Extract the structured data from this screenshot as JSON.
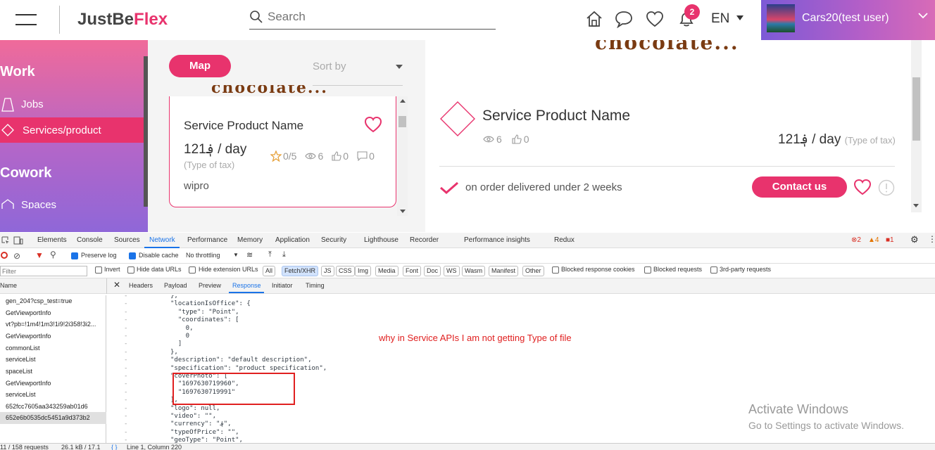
{
  "header": {
    "logo_part1": "JustBe",
    "logo_part2": "Flex",
    "search_placeholder": "Search",
    "notification_count": "2",
    "language": "EN",
    "user_name": "Cars20(test user)"
  },
  "sidebar": {
    "section_work": "Work",
    "item_jobs": "Jobs",
    "item_services": "Services/product",
    "section_cowork": "Cowork",
    "item_spaces": "Spaces"
  },
  "listing": {
    "map_button": "Map",
    "sort_by": "Sort by",
    "card": {
      "title": "Service Product Name",
      "price": "121؋ / day",
      "tax": "(Type of tax)",
      "rating": "0/5",
      "views": "6",
      "likes": "0",
      "comments": "0",
      "company": "wipro"
    }
  },
  "detail": {
    "banner_text": "chocolate...",
    "title": "Service Product Name",
    "views": "6",
    "likes": "0",
    "price": "121؋ / day",
    "tax": "(Type of tax)",
    "delivery": "on order delivered under 2 weeks",
    "contact_button": "Contact us"
  },
  "devtools": {
    "tabs": [
      "Elements",
      "Console",
      "Sources",
      "Network",
      "Performance",
      "Memory",
      "Application",
      "Security",
      "Lighthouse",
      "Recorder",
      "Performance insights",
      "Redux"
    ],
    "errors": "2",
    "warnings": "4",
    "issues": "1",
    "toolbar": {
      "preserve_log": "Preserve log",
      "disable_cache": "Disable cache",
      "throttling": "No throttling"
    },
    "filter_placeholder": "Filter",
    "filter_options": [
      "Invert",
      "Hide data URLs",
      "Hide extension URLs"
    ],
    "types": [
      "All",
      "Fetch/XHR",
      "JS",
      "CSS",
      "Img",
      "Media",
      "Font",
      "Doc",
      "WS",
      "Wasm",
      "Manifest",
      "Other"
    ],
    "filter_checks": [
      "Blocked response cookies",
      "Blocked requests",
      "3rd-party requests"
    ],
    "list_header": "Name",
    "requests": [
      "gen_204?csp_test=true",
      "GetViewportInfo",
      "vt?pb=!1m4!1m3!1i9!2i358!3i2...",
      "GetViewportInfo",
      "commonList",
      "serviceList",
      "spaceList",
      "GetViewportInfo",
      "serviceList",
      "652fcc7605aa343259ab01d6",
      "652e6b0535dc5451a9d373b2"
    ],
    "detail_tabs": [
      "Headers",
      "Payload",
      "Preview",
      "Response",
      "Initiator",
      "Timing"
    ],
    "code_lines": [
      "},",
      "\"locationIsOffice\": {",
      "  \"type\": \"Point\",",
      "  \"coordinates\": [",
      "    0,",
      "    0",
      "  ]",
      "},",
      "\"description\": \"default description\",",
      "\"specification\": \"product specification\",",
      "\"coverPhoto\": [",
      "  \"1697630719960\",",
      "  \"1697630719991\"",
      "],",
      "\"logo\": null,",
      "\"video\": \"\",",
      "\"currency\": \"؋\",",
      "\"typeOfPrice\": \"\",",
      "\"geoType\": \"Point\","
    ],
    "annotation": "why in Service APIs I am not getting Type of file",
    "status_requests": "11 / 158 requests",
    "status_size": "26.1 kB / 17.1",
    "status_position": "Line 1, Column 220"
  },
  "watermark": {
    "line1": "Activate Windows",
    "line2": "Go to Settings to activate Windows."
  }
}
